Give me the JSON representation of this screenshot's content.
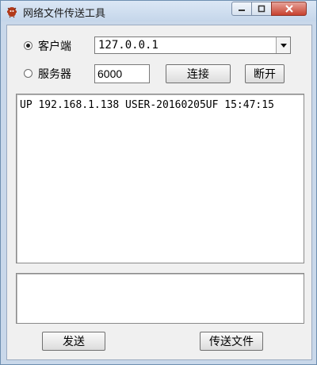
{
  "window": {
    "title": "网络文件传送工具"
  },
  "mode": {
    "client_label": "客户端",
    "server_label": "服务器",
    "selected": "client"
  },
  "connection": {
    "address_value": "127.0.0.1",
    "port_value": "6000",
    "connect_label": "连接",
    "disconnect_label": "断开"
  },
  "log": {
    "lines": [
      "UP 192.168.1.138 USER-20160205UF 15:47:15"
    ]
  },
  "message": {
    "value": ""
  },
  "actions": {
    "send_label": "发送",
    "send_file_label": "传送文件"
  }
}
